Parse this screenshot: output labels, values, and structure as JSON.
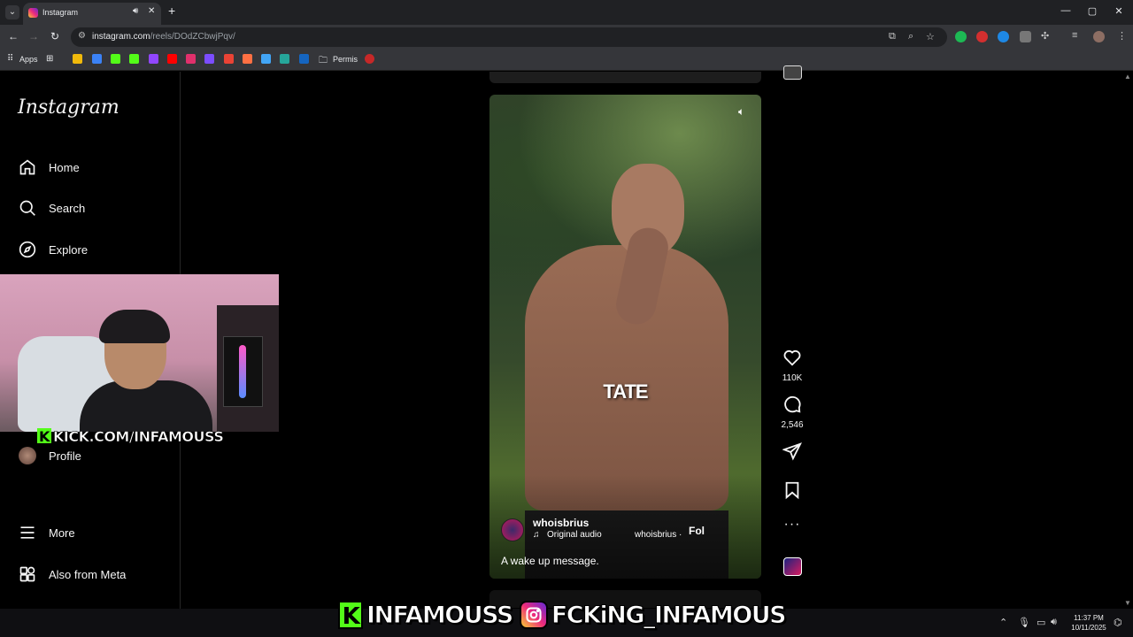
{
  "browser": {
    "tab_title": "Instagram",
    "url_host": "instagram.com",
    "url_path": "/reels/DOdZCbwjPqv/",
    "bookmarks": {
      "apps_label": "Apps",
      "folder_label": "Permis"
    },
    "window_controls": {
      "minimize": "—",
      "maximize": "▢",
      "close": "✕"
    }
  },
  "sidebar": {
    "logo": "Instagram",
    "nav": [
      {
        "label": "Home",
        "icon": "home-icon"
      },
      {
        "label": "Search",
        "icon": "search-icon"
      },
      {
        "label": "Explore",
        "icon": "compass-icon"
      }
    ],
    "profile_label": "Profile",
    "more_label": "More",
    "meta_label": "Also from Meta"
  },
  "stream_overlay": {
    "webcam_banner": "KICK.COM/INFAMOUSS",
    "kick_letter": "K",
    "bottom_kick_handle": "INFAMOUSS",
    "bottom_ig_handle": "FCKiNG_INFAMOUS"
  },
  "reel": {
    "overlay_text": "TATE",
    "author": "whoisbrius",
    "audio_label": "Original audio",
    "audio_artist": "whoisbrius ·",
    "follow_label": "Fol",
    "caption": "A wake up message.",
    "likes": "110K",
    "comments": "2,546"
  },
  "taskbar": {
    "time": "11:37 PM",
    "date": "10/11/2025"
  },
  "colors": {
    "kick_green": "#53fc18",
    "background": "#000000",
    "chrome_dark": "#202124",
    "chrome_toolbar": "#35363a"
  }
}
